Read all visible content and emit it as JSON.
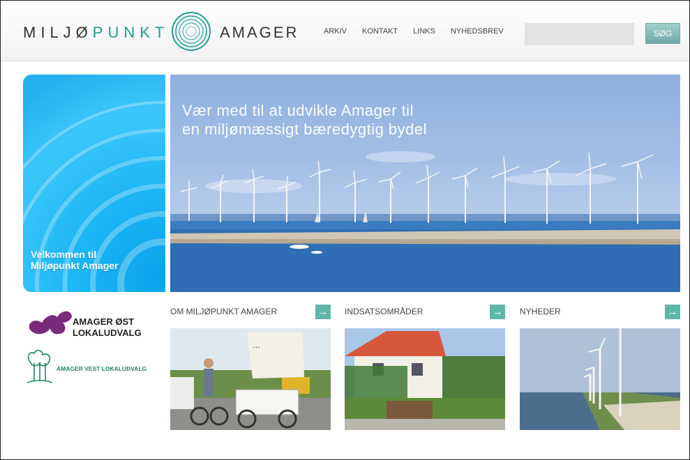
{
  "header": {
    "logo_left": "MILJØ",
    "logo_left_accent": "PUNKT",
    "logo_right": "AMAGER",
    "nav": [
      "ARKIV",
      "KONTAKT",
      "LINKS",
      "NYHEDSBREV"
    ],
    "search_button": "SØG",
    "search_placeholder": ""
  },
  "welcome": {
    "line1": "Velkommen til",
    "line2": "Miljøpunkt Amager"
  },
  "hero": {
    "line1": "Vær med til at udvikle Amager til",
    "line2": "en miljømæssigt bæredygtig bydel"
  },
  "sponsors": {
    "east_line1": "AMAGER ØST",
    "east_line2": "LOKALUDVALG",
    "west": "AMAGER VEST LOKALUDVALG"
  },
  "cards": [
    {
      "title": "OM MILJØPUNKT AMAGER",
      "arrow": "→"
    },
    {
      "title": "INDSATSOMRÅDER",
      "arrow": "→"
    },
    {
      "title": "NYHEDER",
      "arrow": "→"
    }
  ],
  "colors": {
    "accent": "#1b9e8f",
    "arrow": "#5fb7a8",
    "welcome_blue": "#1cb5f5"
  }
}
